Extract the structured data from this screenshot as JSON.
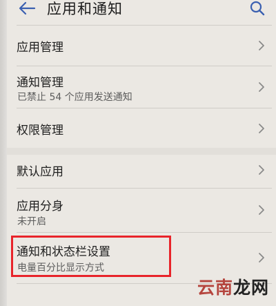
{
  "header": {
    "title": "应用和通知",
    "back_icon": "back-arrow-icon",
    "search_icon": "search-icon"
  },
  "items": [
    {
      "label": "应用管理",
      "sub": ""
    },
    {
      "label": "通知管理",
      "sub": "已禁止 54 个应用发送通知"
    },
    {
      "label": "权限管理",
      "sub": ""
    },
    {
      "label": "默认应用",
      "sub": ""
    },
    {
      "label": "应用分身",
      "sub": "未开启"
    },
    {
      "label": "通知和状态栏设置",
      "sub": "电量百分比显示方式"
    }
  ],
  "highlight_color": "#e8242a",
  "watermark": {
    "part1": "云南",
    "part2": "龙网"
  }
}
